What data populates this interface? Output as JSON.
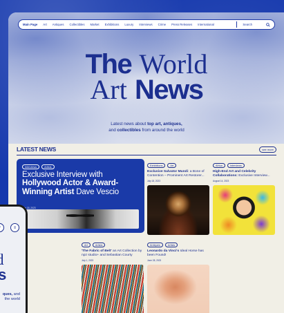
{
  "nav": {
    "items": [
      "Main Page",
      "Art",
      "Antiques",
      "Collectibles",
      "Market",
      "Exhibitions",
      "Luxury",
      "Interviews",
      "Crime",
      "Press Releases",
      "International"
    ],
    "search_label": "Search",
    "search_icon": "search-icon"
  },
  "hero": {
    "title_part1_bold": "The",
    "title_part1_light": "World",
    "title_part2_light": "Art",
    "title_part2_bold": "News",
    "tagline_1": "Latest news about ",
    "tagline_bold_1": "top art, antiques,",
    "tagline_2": "and ",
    "tagline_bold_2": "collectibles",
    "tagline_3": " from around the world"
  },
  "section": {
    "title": "LATEST NEWS",
    "see_more": "see more"
  },
  "feature": {
    "tags": [
      "Interviews",
      "Artists"
    ],
    "title_1": "Exclusive Interview with",
    "title_bold": "Hollywood Actor & Award-Winning Artist",
    "title_2": " Dave Vescio",
    "date": "July 18, 2023"
  },
  "cards": [
    {
      "tags": [
        "Exhibitions",
        "Art"
      ],
      "title_bold": "Exclusive Salvator Mundi",
      "title_rest": ": a Bone of Contention – Prominent Art Restorer...",
      "date": "July 18, 2023"
    },
    {
      "tags": [
        "Africa",
        "Interviews"
      ],
      "title_bold": "High-End Art and Celebrity Collaborations:",
      "title_rest": " Exclusive Interview...",
      "date": "August 14, 2023"
    },
    {
      "tags": [
        "Art",
        "Artists"
      ],
      "title_bold": "'The Fabric of Belt'",
      "title_rest": " an Art Collection by npz studio+ and Sebastian Courty",
      "date": "July 1, 2023"
    },
    {
      "tags": [
        "Antiques",
        "Artists"
      ],
      "title_bold": "Leonardo da Vinci's",
      "title_rest": " Ideal Horse has been Found!",
      "date": "June 28, 2023"
    }
  ],
  "phone": {
    "title_l1": "rld",
    "title_l2": "ws",
    "tag_bold": "ques,",
    "tag_rest_1": " and",
    "tag_rest_2": "the world"
  }
}
